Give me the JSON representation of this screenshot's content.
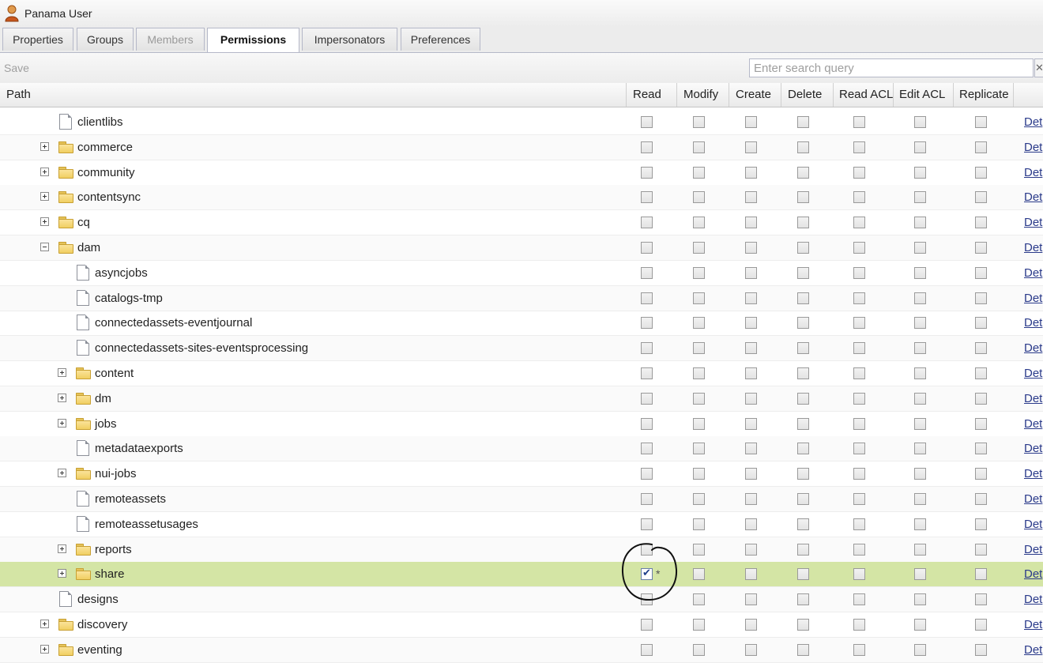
{
  "window": {
    "title": "Panama User"
  },
  "tabs": [
    {
      "label": "Properties",
      "state": "normal"
    },
    {
      "label": "Groups",
      "state": "normal"
    },
    {
      "label": "Members",
      "state": "disabled"
    },
    {
      "label": "Permissions",
      "state": "active"
    },
    {
      "label": "Impersonators",
      "state": "normal"
    },
    {
      "label": "Preferences",
      "state": "normal"
    }
  ],
  "toolbar": {
    "save_label": "Save",
    "search_placeholder": "Enter search query"
  },
  "columns": [
    "Path",
    "Read",
    "Modify",
    "Create",
    "Delete",
    "Read ACL",
    "Edit ACL",
    "Replicate"
  ],
  "details_label": "Det",
  "rows": [
    {
      "name": "clientlibs",
      "type": "file",
      "level": 1,
      "expander": "none",
      "read": false,
      "selected": false
    },
    {
      "name": "commerce",
      "type": "folder",
      "level": 1,
      "expander": "plus",
      "read": false,
      "selected": false
    },
    {
      "name": "community",
      "type": "folder",
      "level": 1,
      "expander": "plus",
      "read": false,
      "selected": false
    },
    {
      "name": "contentsync",
      "type": "folder",
      "level": 1,
      "expander": "plus",
      "read": false,
      "selected": false
    },
    {
      "name": "cq",
      "type": "folder",
      "level": 1,
      "expander": "plus",
      "read": false,
      "selected": false
    },
    {
      "name": "dam",
      "type": "folder",
      "level": 1,
      "expander": "minus",
      "read": false,
      "selected": false
    },
    {
      "name": "asyncjobs",
      "type": "file",
      "level": 2,
      "expander": "none",
      "read": false,
      "selected": false
    },
    {
      "name": "catalogs-tmp",
      "type": "file",
      "level": 2,
      "expander": "none",
      "read": false,
      "selected": false
    },
    {
      "name": "connectedassets-eventjournal",
      "type": "file",
      "level": 2,
      "expander": "none",
      "read": false,
      "selected": false
    },
    {
      "name": "connectedassets-sites-eventsprocessing",
      "type": "file",
      "level": 2,
      "expander": "none",
      "read": false,
      "selected": false
    },
    {
      "name": "content",
      "type": "folder",
      "level": 2,
      "expander": "plus",
      "read": false,
      "selected": false
    },
    {
      "name": "dm",
      "type": "folder",
      "level": 2,
      "expander": "plus",
      "read": false,
      "selected": false
    },
    {
      "name": "jobs",
      "type": "folder",
      "level": 2,
      "expander": "plus",
      "read": false,
      "selected": false
    },
    {
      "name": "metadataexports",
      "type": "file",
      "level": 2,
      "expander": "none",
      "read": false,
      "selected": false
    },
    {
      "name": "nui-jobs",
      "type": "folder",
      "level": 2,
      "expander": "plus",
      "read": false,
      "selected": false
    },
    {
      "name": "remoteassets",
      "type": "file",
      "level": 2,
      "expander": "none",
      "read": false,
      "selected": false
    },
    {
      "name": "remoteassetusages",
      "type": "file",
      "level": 2,
      "expander": "none",
      "read": false,
      "selected": false
    },
    {
      "name": "reports",
      "type": "folder",
      "level": 2,
      "expander": "plus",
      "read": false,
      "selected": false
    },
    {
      "name": "share",
      "type": "folder",
      "level": 2,
      "expander": "plus",
      "read": true,
      "read_marker": "*",
      "selected": true
    },
    {
      "name": "designs",
      "type": "file",
      "level": 1,
      "expander": "none",
      "read": false,
      "selected": false
    },
    {
      "name": "discovery",
      "type": "folder",
      "level": 1,
      "expander": "plus",
      "read": false,
      "selected": false
    },
    {
      "name": "eventing",
      "type": "folder",
      "level": 1,
      "expander": "plus",
      "read": false,
      "selected": false
    }
  ]
}
